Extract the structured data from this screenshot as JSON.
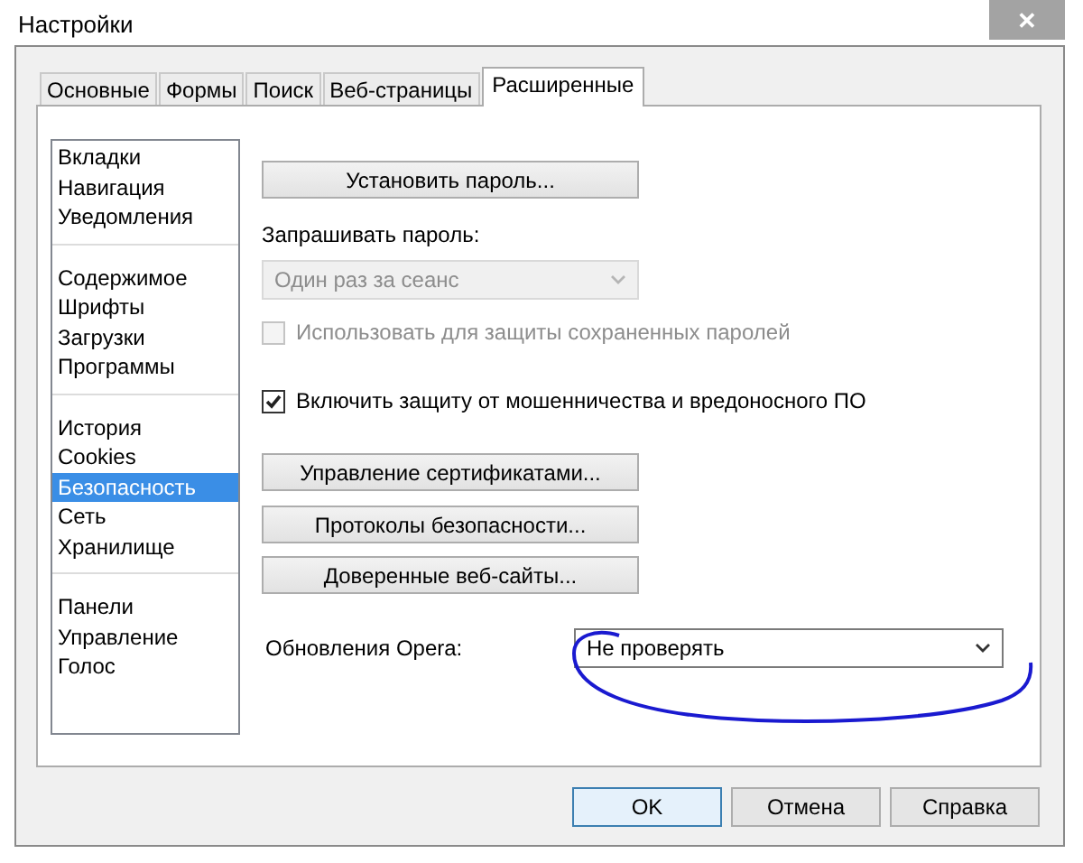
{
  "window": {
    "title": "Настройки",
    "close": "✕"
  },
  "tabs": [
    {
      "label": "Основные",
      "selected": false
    },
    {
      "label": "Формы",
      "selected": false
    },
    {
      "label": "Поиск",
      "selected": false
    },
    {
      "label": "Веб-страницы",
      "selected": false
    },
    {
      "label": "Расширенные",
      "selected": true
    }
  ],
  "sidebar": {
    "groups": [
      [
        {
          "label": "Вкладки",
          "selected": false
        },
        {
          "label": "Навигация",
          "selected": false
        },
        {
          "label": "Уведомления",
          "selected": false
        }
      ],
      [
        {
          "label": "Содержимое",
          "selected": false
        },
        {
          "label": "Шрифты",
          "selected": false
        },
        {
          "label": "Загрузки",
          "selected": false
        },
        {
          "label": "Программы",
          "selected": false
        }
      ],
      [
        {
          "label": "История",
          "selected": false
        },
        {
          "label": "Cookies",
          "selected": false
        },
        {
          "label": "Безопасность",
          "selected": true
        },
        {
          "label": "Сеть",
          "selected": false
        },
        {
          "label": "Хранилище",
          "selected": false
        }
      ],
      [
        {
          "label": "Панели",
          "selected": false
        },
        {
          "label": "Управление",
          "selected": false
        },
        {
          "label": "Голос",
          "selected": false
        }
      ]
    ]
  },
  "controls": [
    {
      "kind": "button",
      "label": "Установить пароль..."
    },
    {
      "kind": "label",
      "label": "Запрашивать пароль:"
    },
    {
      "kind": "select",
      "value": "Один раз за сеанс",
      "disabled": true
    },
    {
      "kind": "checkbox",
      "label": "Использовать для защиты сохраненных паролей",
      "checked": false,
      "disabled": true
    },
    {
      "kind": "checkbox",
      "label": "Включить защиту от мошенничества и вредоносного ПО",
      "checked": true,
      "disabled": false
    },
    {
      "kind": "button",
      "label": "Управление сертификатами..."
    },
    {
      "kind": "button",
      "label": "Протоколы безопасности..."
    },
    {
      "kind": "button",
      "label": "Доверенные веб-сайты..."
    },
    {
      "kind": "setting",
      "label": "Обновления Opera:",
      "value": "Не проверять",
      "disabled": false
    }
  ],
  "buttons": [
    {
      "label": "OK",
      "default": true
    },
    {
      "label": "Отмена",
      "default": false
    },
    {
      "label": "Справка",
      "default": false
    }
  ]
}
